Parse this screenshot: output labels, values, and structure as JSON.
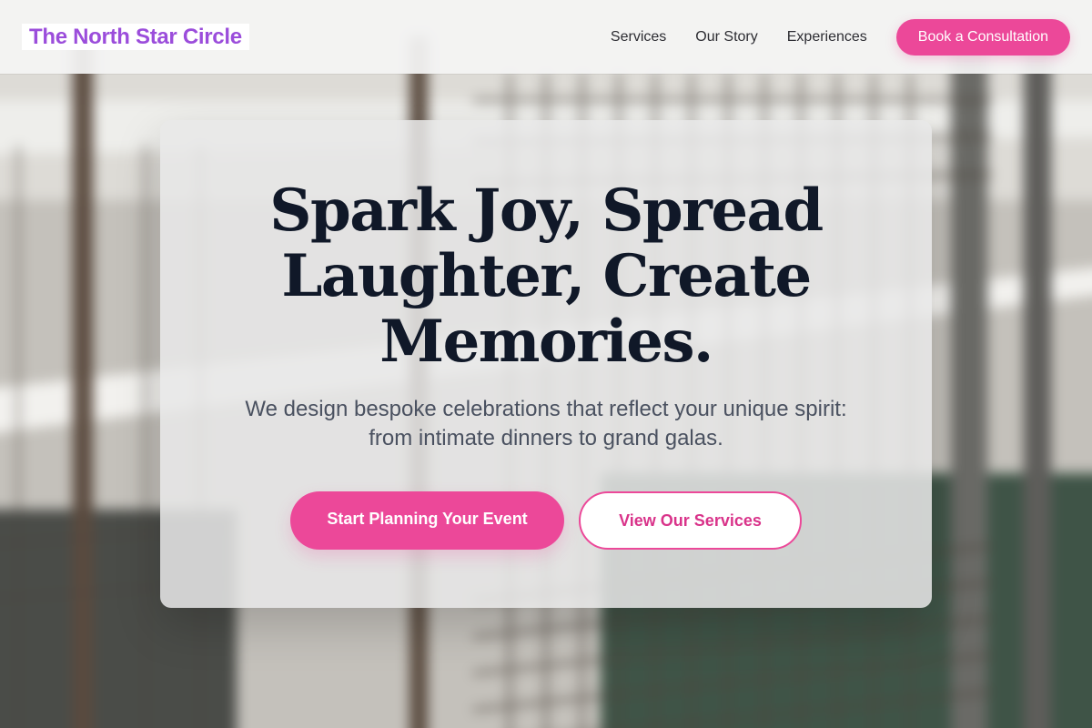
{
  "brand": {
    "name": "The North Star Circle",
    "accent_color": "#9b4ddb",
    "primary_color": "#ec4899"
  },
  "nav": {
    "links": [
      {
        "label": "Services"
      },
      {
        "label": "Our Story"
      },
      {
        "label": "Experiences"
      }
    ],
    "cta_label": "Book a Consultation"
  },
  "hero": {
    "title": "Spark Joy, Spread Laughter, Create Memories.",
    "subtitle": "We design bespoke celebrations that reflect your unique spirit: from intimate dinners to grand galas.",
    "primary_button": "Start Planning Your Event",
    "secondary_button": "View Our Services",
    "background_image": "blurred-wire-fence-photo"
  }
}
